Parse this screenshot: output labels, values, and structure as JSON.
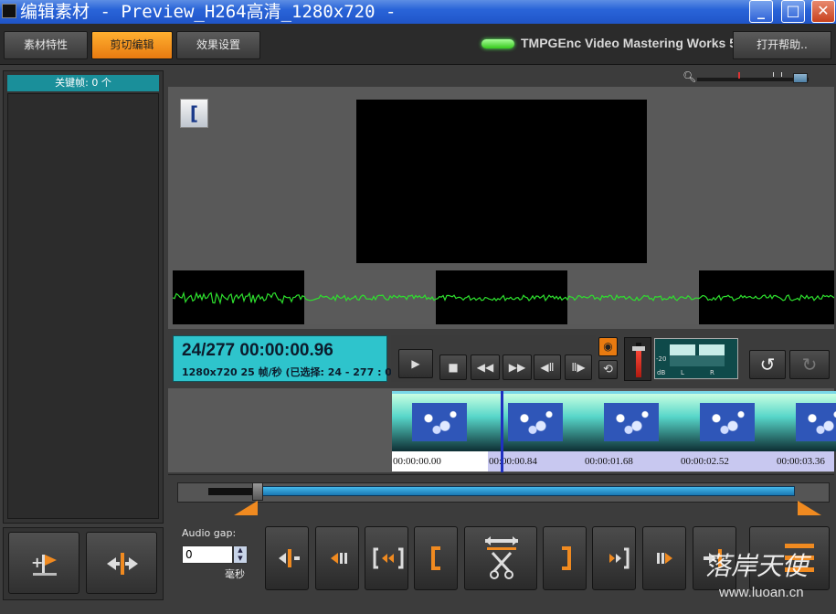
{
  "window": {
    "title": "编辑素材  - Preview_H264高清_1280x720 -"
  },
  "toolbar": {
    "tabs": [
      {
        "label": "素材特性",
        "active": false
      },
      {
        "label": "剪切编辑",
        "active": true
      },
      {
        "label": "效果设置",
        "active": false
      }
    ],
    "brand": "TMPGEnc Video Mastering Works 5",
    "help_label": "打开帮助.."
  },
  "keyframes": {
    "header": "关键帧: 0 个"
  },
  "preview": {
    "bracket_glyph": "[",
    "zoom_icon": "magnifier-icon"
  },
  "timecode": {
    "main": "24/277  00:00:00.96",
    "sub": "1280x720 25  帧/秒 (已选择: 24 - 277 : 0"
  },
  "meter": {
    "labels": [
      "dB",
      "L",
      "R"
    ],
    "scale": "-20"
  },
  "thumbnails": {
    "times": [
      "00:00:00.00",
      "00:00:00.84",
      "00:00:01.68",
      "00:00:02.52",
      "00:00:03.36"
    ],
    "playhead_fraction": 0.087
  },
  "trim": {
    "audio_gap_label": "Audio gap:",
    "audio_gap_value": "0",
    "unit": "毫秒",
    "in_fraction": 0.087,
    "out_fraction": 1.0
  },
  "watermark": {
    "text": "落岸天使",
    "url": "www.luoan.cn"
  },
  "colors": {
    "accent": "#f08a20",
    "timecode_bg": "#2ec4cc",
    "titlebar": "#2a64d8"
  }
}
